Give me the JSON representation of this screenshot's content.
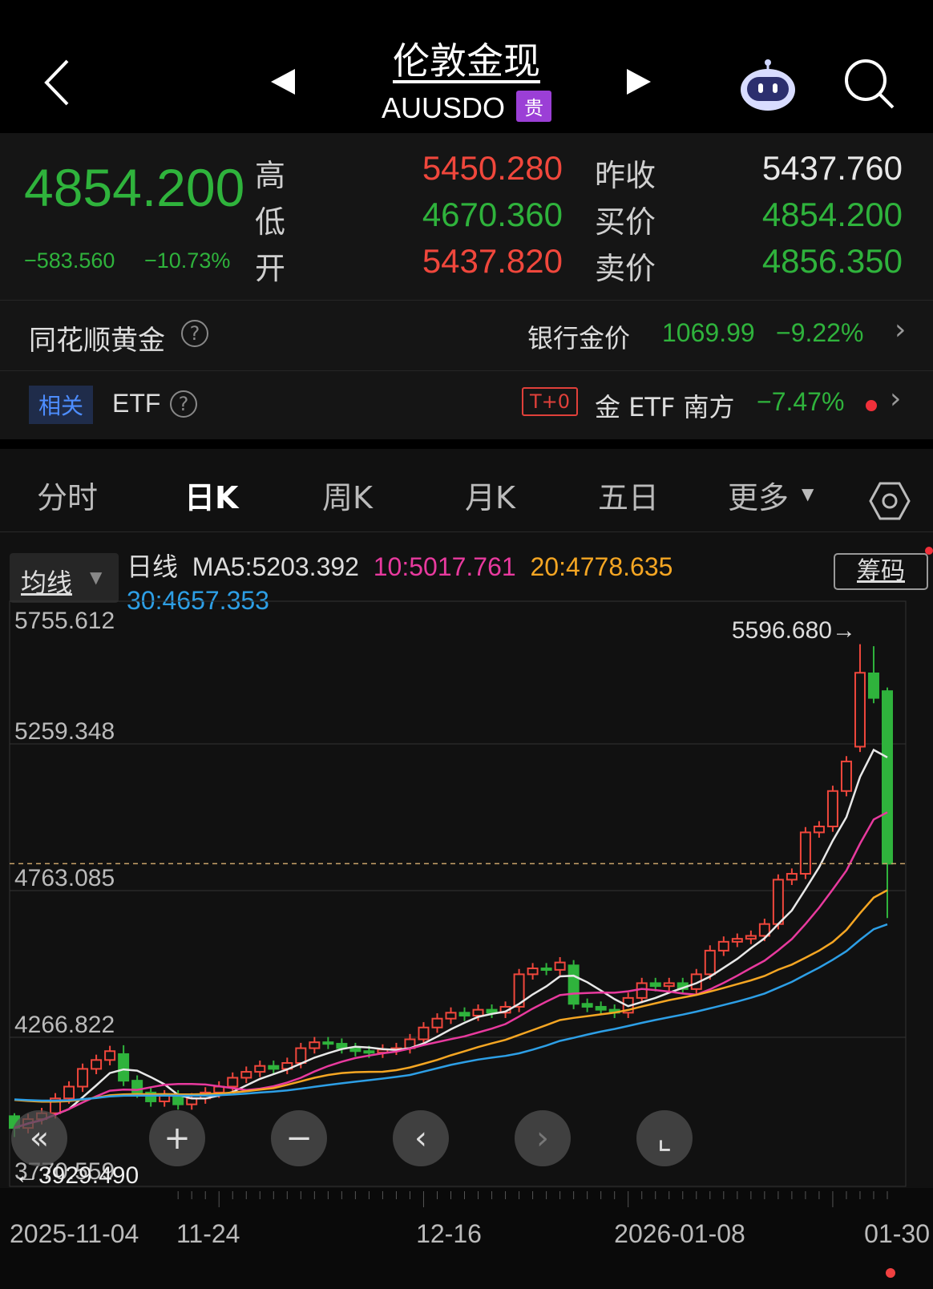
{
  "header": {
    "title": "伦敦金现",
    "code": "AUUSDO",
    "badge": "贵"
  },
  "quote": {
    "price": "4854.200",
    "change": "−583.560",
    "change_pct": "−10.73%",
    "stats": [
      {
        "label": "高",
        "value": "5450.280",
        "tone": "red"
      },
      {
        "label": "低",
        "value": "4670.360",
        "tone": "grn"
      },
      {
        "label": "开",
        "value": "5437.820",
        "tone": "red"
      }
    ],
    "stats2": [
      {
        "label": "昨收",
        "value": "5437.760",
        "tone": "wht"
      },
      {
        "label": "买价",
        "value": "4854.200",
        "tone": "grn"
      },
      {
        "label": "卖价",
        "value": "4856.350",
        "tone": "grn"
      }
    ]
  },
  "gold_row": {
    "label": "同花顺黄金",
    "bank_label": "银行金价",
    "bank_price": "1069.99",
    "bank_pct": "−9.22%"
  },
  "etf_row": {
    "tag": "相关",
    "label": "ETF",
    "t0": "T+0",
    "name": "金 ETF 南方",
    "pct": "−7.47%"
  },
  "tabs": [
    "分时",
    "日K",
    "周K",
    "月K",
    "五日",
    "更多"
  ],
  "active_tab": 1,
  "legend": {
    "ma_select": "均线",
    "type": "日线",
    "ma5": "MA5:5203.392",
    "ma10": "10:5017.761",
    "ma20": "20:4778.635",
    "ma30": "30:4657.353",
    "chips": "筹码"
  },
  "colors": {
    "up": "#f0473c",
    "down": "#2fb33c",
    "ma5": "#e8e8e8",
    "ma10": "#e83a9e",
    "ma20": "#f5a623",
    "ma30": "#2d9fe6"
  },
  "chart_data": {
    "type": "candlestick",
    "y_ticks": [
      "5755.612",
      "5259.348",
      "4763.085",
      "4266.822",
      "3770.559"
    ],
    "ylim": [
      3770.559,
      5755.612
    ],
    "x_labels": [
      "2025-11-04",
      "11-24",
      "12-16",
      "2026-01-08",
      "01-30"
    ],
    "max_marker": "5596.680→",
    "min_marker": "←3929.490",
    "last_price": 4854.2,
    "closes": [
      3960,
      3990,
      4010,
      4060,
      4100,
      4160,
      4190,
      4220,
      4120,
      4080,
      4050,
      4070,
      4040,
      4060,
      4080,
      4100,
      4130,
      4150,
      4170,
      4160,
      4180,
      4230,
      4250,
      4245,
      4230,
      4220,
      4215,
      4225,
      4230,
      4260,
      4300,
      4330,
      4350,
      4340,
      4360,
      4350,
      4370,
      4480,
      4500,
      4495,
      4520,
      4380,
      4370,
      4360,
      4350,
      4400,
      4450,
      4440,
      4450,
      4430,
      4480,
      4560,
      4590,
      4600,
      4610,
      4650,
      4800,
      4820,
      4960,
      4980,
      5100,
      5200,
      5500,
      5415,
      4854.2
    ],
    "open_overrides": {
      "0": 4000,
      "8": 4210,
      "41": 4510,
      "62": 5250,
      "63": 5498,
      "64": 5437.82
    },
    "high_overrides": {
      "62": 5596.68,
      "63": 5590,
      "64": 5450.28,
      "0": 4010,
      "8": 4240
    },
    "low_overrides": {
      "64": 4670.36,
      "0": 3929.49
    }
  },
  "nav": [
    "«",
    "+",
    "−",
    "‹",
    "›",
    "⌞"
  ]
}
